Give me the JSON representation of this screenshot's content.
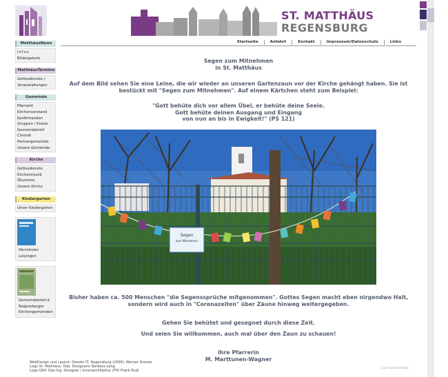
{
  "brand": {
    "line1": "ST. MATTHÄUS",
    "line2": "REGENSBURG"
  },
  "colors": {
    "purple": "#7a3b86",
    "text": "#555e6e"
  },
  "topnav": [
    "Startseite",
    "Anfahrt",
    "Kontakt",
    "Impressum/Datenschutz",
    "Links"
  ],
  "sidebar": {
    "news": {
      "title": "MatthäusNews",
      "items": [
        "Infos",
        "Bildergalerie"
      ]
    },
    "termine": {
      "title": "MatthäusTermine",
      "items": [
        "Gottesdienste /",
        "Veranstaltungen"
      ]
    },
    "gemeinde": {
      "title": "Gemeinde",
      "items": [
        "Pfarramt",
        "Kirchenvorstand",
        "Konfirmanden",
        "Gruppen / Kreise",
        "Gemeindebrief",
        "Chronik",
        "Partnergemeinde",
        "Unsere Gemeinde"
      ]
    },
    "kirche": {
      "title": "Kirche",
      "items": [
        "Gottesdienste",
        "Kirchenmusik",
        "Ökumene",
        "Unsere Kirche"
      ]
    },
    "kindergarten": {
      "title": "Kindergarten",
      "items": [
        "Unser Kindergarten"
      ]
    },
    "losungen": {
      "items": [
        "Herrnhuter",
        "Losungen"
      ]
    },
    "gemeindebrief": {
      "items": [
        "Gemeindebrief d.",
        "Regensburger",
        "Kirchengemeinden"
      ]
    }
  },
  "main": {
    "title1": "Segen zum Mitnehmen",
    "title2": "in St. Matthäus",
    "intro": "Auf dem Bild sehen Sie eine Leine, die wir wieder an unseren Gartenzaun vor der Kirche gehängt haben. Sie ist bestückt mit \"Segen zum Mitnehmen\". Auf einem Kärtchen steht zum Beispiel:",
    "quote1": "\"Gott behüte dich vor allem Übel, er behüte deine Seele.",
    "quote2": "Gott behüte deinen Ausgang und Eingang",
    "quote3": "von nun an bis in Ewigkeit!\" (PS 121)",
    "photo_sign": [
      "Segen",
      "zum Mitnehmen"
    ],
    "after1": "Bisher haben ca. 500 Menschen \"die Segenssprüche mitgenommen\". Gottes Segen macht eben nirgendwo Halt,",
    "after2": "sondern wird auch in \"Coronazeiten\" über Zäune hinweg weitergegeben.",
    "bless": "Gehen Sie behütet und gesegnet durch diese Zeit.",
    "welcome": "Und seien Sie willkommen, auch mal über den Zaun zu schauen!",
    "sig1": "Ihre Pfarrerin",
    "sig2": "M. Marttunen-Wagner"
  },
  "footer": {
    "l1": "WebDesign und Layout: Drexler IT, Regensburg (2006), Werner Drexler",
    "l2": "Logo St. Matthäus: Dipl. Designerin Barbara Lang",
    "l3": "Logo GKV: Dipl.Ing. Designer / Innenarchitektur (FH) Frank Rudi",
    "tag": "[zum Seitenanfang]"
  }
}
